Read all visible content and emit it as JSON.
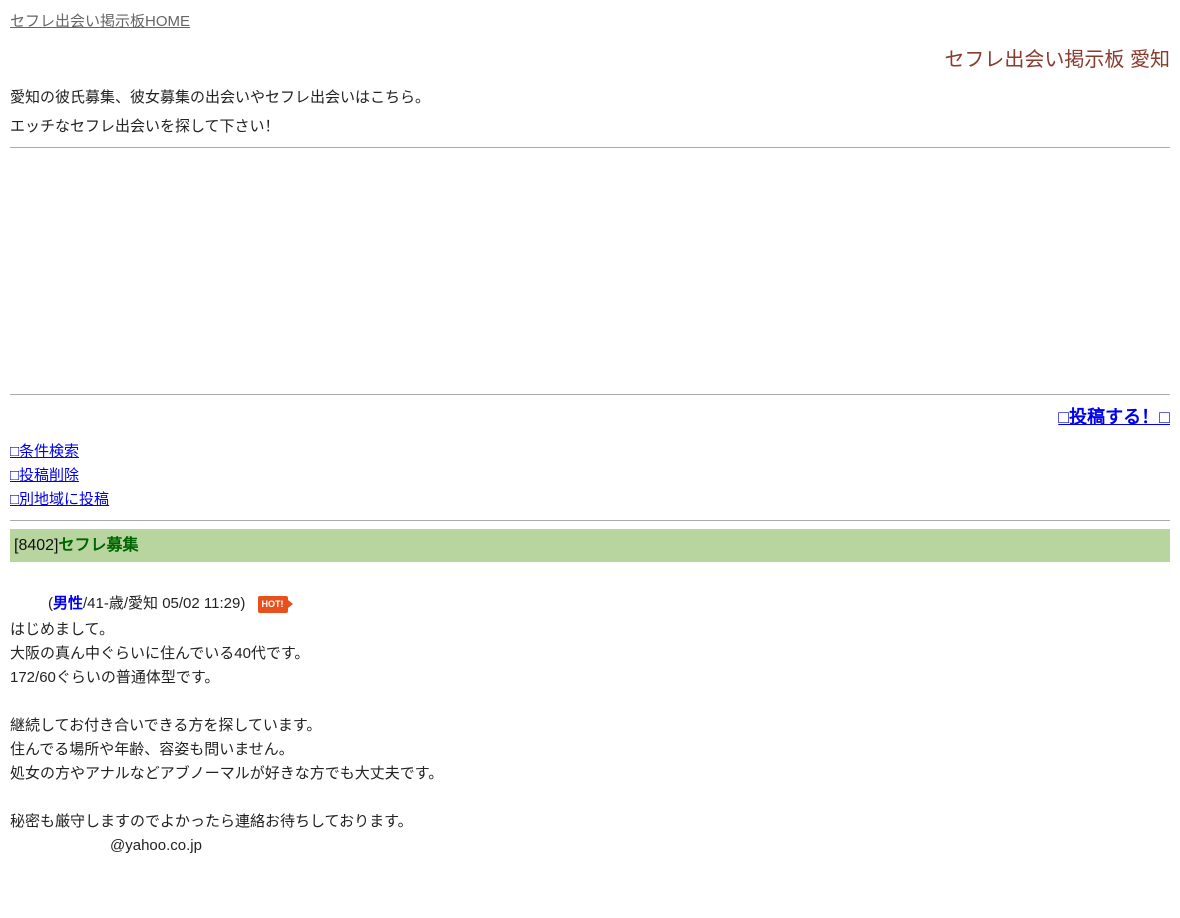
{
  "home_link": "セフレ出会い掲示板HOME",
  "heading": "セフレ出会い掲示板 愛知",
  "intro_line1": "愛知の彼氏募集、彼女募集の出会いやセフレ出会いはこちら。",
  "intro_line2": "エッチなセフレ出会いを探して下さい！",
  "links": {
    "post": "□投稿する！□",
    "search": "□条件検索",
    "delete": "□投稿削除",
    "other_region": "□別地域に投稿"
  },
  "post": {
    "id": "[8402]",
    "title": "セフレ募集",
    "meta_prefix": " (",
    "gender": "男性",
    "meta_rest": "/41-歳/愛知 05/02 11:29)",
    "hot_label": "HOT!",
    "body": "はじめまして。\n大阪の真ん中ぐらいに住んでいる40代です。\n172/60ぐらいの普通体型です。\n\n継続してお付き合いできる方を探しています。\n住んでる場所や年齢、容姿も問いません。\n処女の方やアナルなどアブノーマルが好きな方でも大丈夫です。\n\n秘密も厳守しますのでよかったら連絡お待ちしております。",
    "email": "@yahoo.co.jp"
  }
}
